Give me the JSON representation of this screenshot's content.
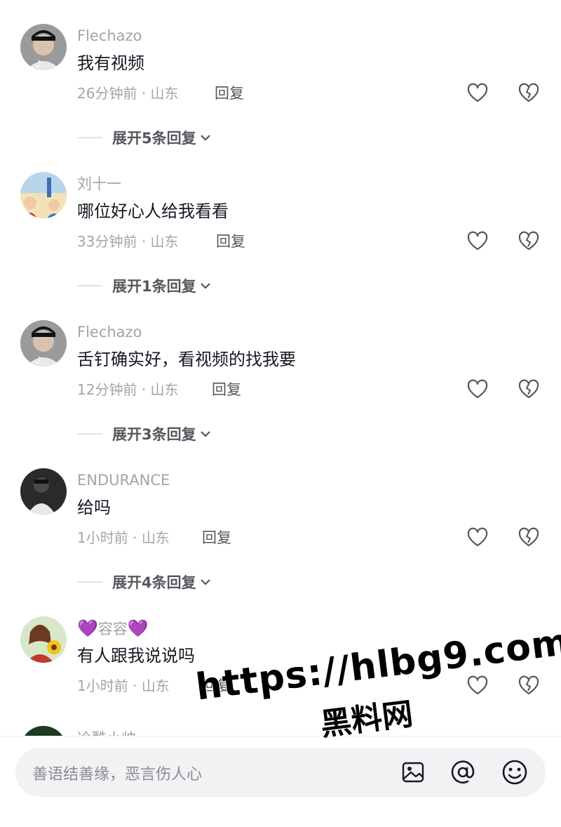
{
  "comments": [
    {
      "username": "Flechazo",
      "text": "我有视频",
      "time": "26分钟前",
      "location": "山东",
      "reply_label": "回复",
      "expand_label": "展开5条回复",
      "avatar": "avatar-man-cap-tiktok"
    },
    {
      "username": "刘十一",
      "text": "哪位好心人给我看看",
      "time": "33分钟前",
      "location": "山东",
      "reply_label": "回复",
      "expand_label": "展开1条回复",
      "avatar": "avatar-cartoon-kids"
    },
    {
      "username": "Flechazo",
      "text": "舌钉确实好，看视频的找我要",
      "time": "12分钟前",
      "location": "山东",
      "reply_label": "回复",
      "expand_label": "展开3条回复",
      "avatar": "avatar-man-cap-tiktok"
    },
    {
      "username": "ENDURANCE",
      "text": "给吗",
      "time": "1小时前",
      "location": "山东",
      "reply_label": "回复",
      "expand_label": "展开4条回复",
      "avatar": "avatar-dark-portrait"
    },
    {
      "username": "容容",
      "username_decor": "💜",
      "text": "有人跟我说说吗",
      "time": "1小时前",
      "location": "山东",
      "reply_label": "回复",
      "avatar": "avatar-girl-sunflower"
    }
  ],
  "partial_comment": {
    "username": "冷酷小帅"
  },
  "separator": "·",
  "input": {
    "placeholder": "善语结善缘，恶言伤人心"
  },
  "watermark": {
    "url": "https://hlbg9.com",
    "site": "黑料网"
  },
  "icons": [
    "like-heart-icon",
    "dislike-broken-heart-icon",
    "chevron-down-icon",
    "image-icon",
    "at-icon",
    "emoji-icon"
  ],
  "colors": {
    "text": "#161823",
    "meta": "#a3a4ab",
    "secondary": "#56575e",
    "input_bg": "#f2f2f4",
    "decor_heart": "#9b3fe6"
  }
}
